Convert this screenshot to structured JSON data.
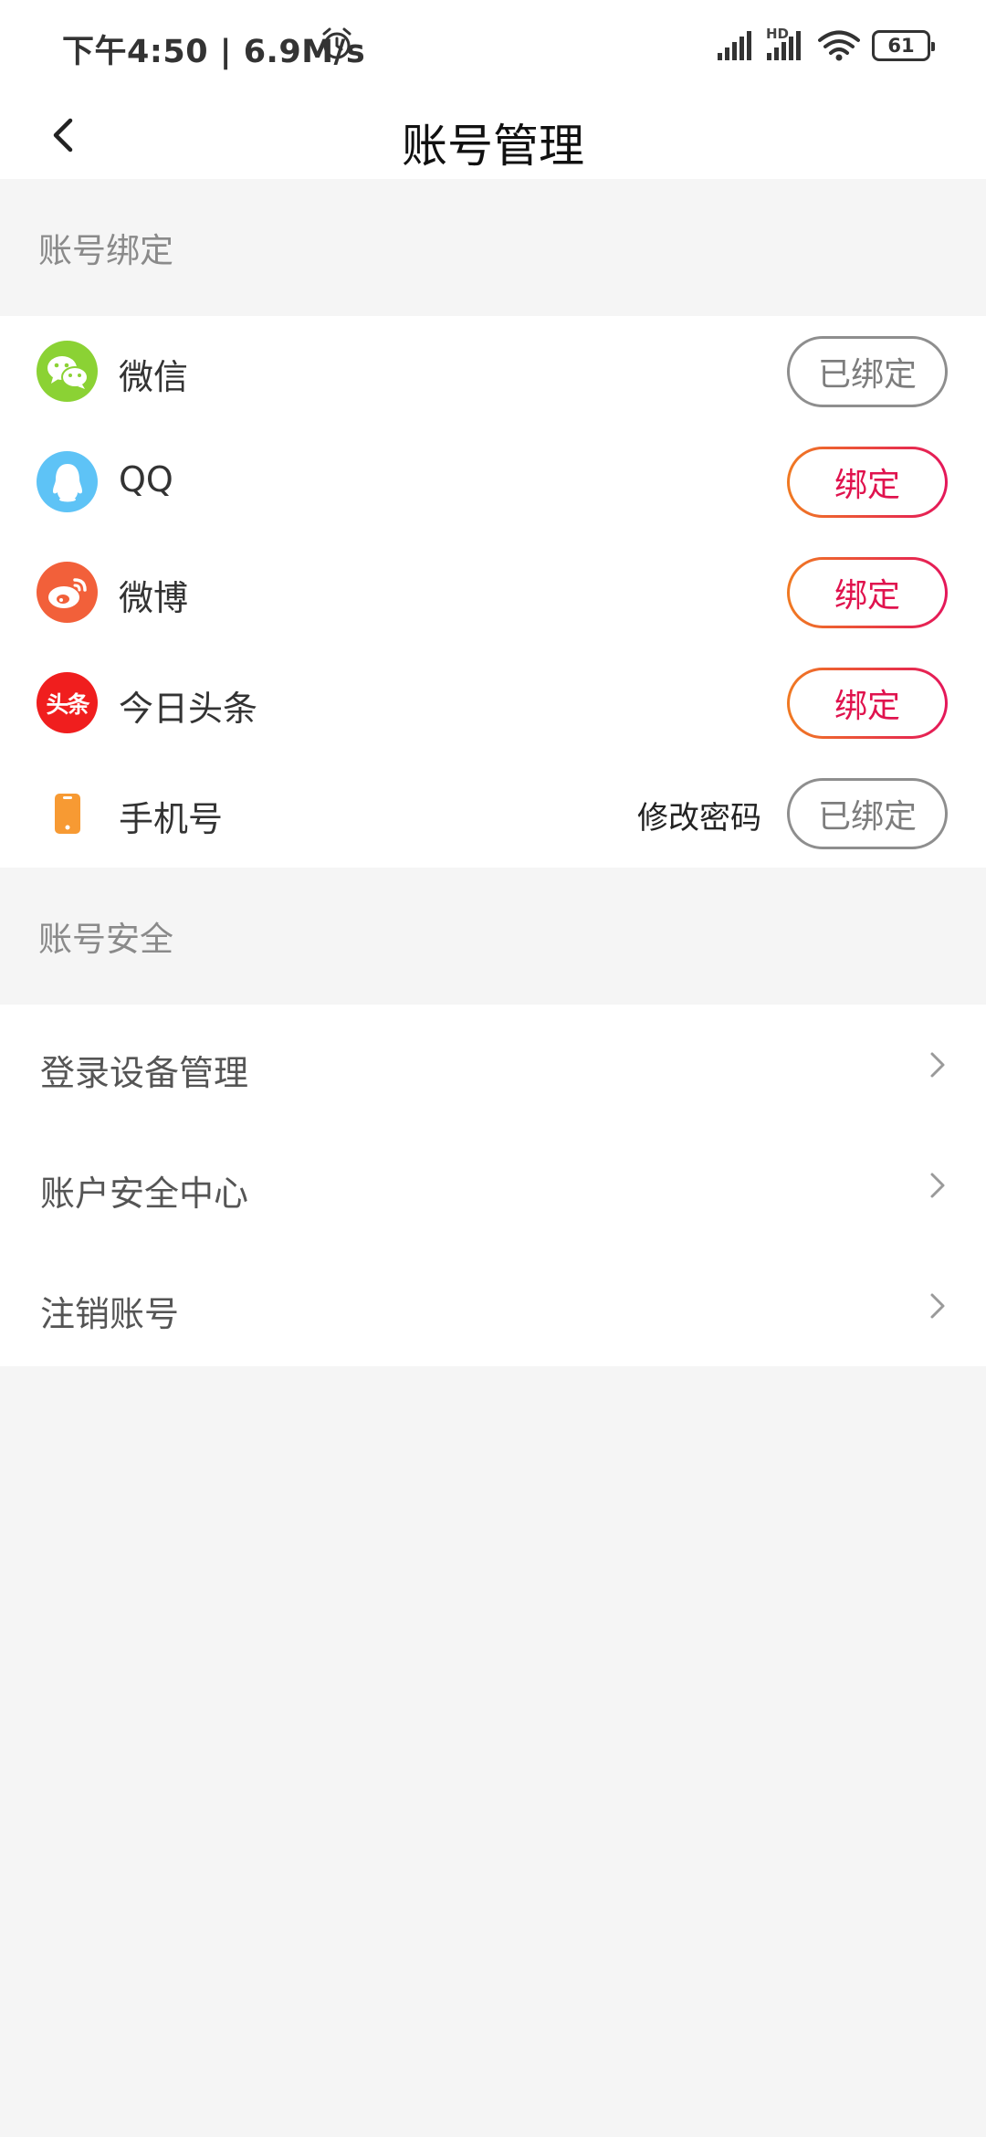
{
  "status_bar": {
    "time": "下午4:50 | 6.9M/s",
    "hd": "HD",
    "battery": "61",
    "icons": [
      "alarm-icon",
      "cellular-signal-icon",
      "cellular-signal-hd-icon",
      "wifi-icon",
      "battery-icon"
    ]
  },
  "header": {
    "title": "账号管理",
    "back_icon": "chevron-left-icon"
  },
  "binding": {
    "section_title": "账号绑定",
    "items": [
      {
        "label": "微信",
        "icon": "wechat-icon",
        "icon_color": "#8bd234",
        "button": "已绑定",
        "status": "bound"
      },
      {
        "label": "QQ",
        "icon": "qq-penguin-icon",
        "icon_color": "#5ec3f6",
        "button": "绑定",
        "status": "unbound"
      },
      {
        "label": "微博",
        "icon": "weibo-icon",
        "icon_color": "#f2603a",
        "button": "绑定",
        "status": "unbound"
      },
      {
        "label": "今日头条",
        "icon": "toutiao-icon",
        "icon_color": "#f01e1e",
        "icon_text": "头条",
        "button": "绑定",
        "status": "unbound"
      },
      {
        "label": "手机号",
        "icon": "phone-icon",
        "icon_color": "#f79a33",
        "button": "已绑定",
        "status": "bound",
        "extra_link": "修改密码"
      }
    ]
  },
  "security": {
    "section_title": "账号安全",
    "items": [
      {
        "label": "登录设备管理"
      },
      {
        "label": "账户安全中心"
      },
      {
        "label": "注销账号"
      }
    ]
  },
  "colors": {
    "accent_gradient_start": "#f07a22",
    "accent_gradient_end": "#e4165a",
    "accent_text": "#e0134e",
    "page_background": "#f5f5f5"
  }
}
